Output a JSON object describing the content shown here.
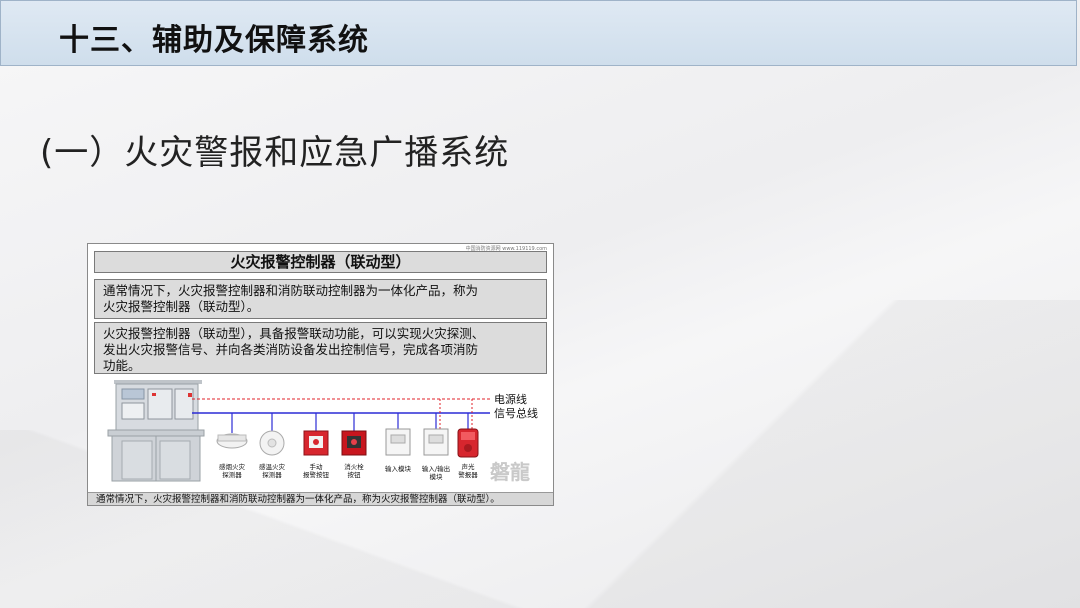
{
  "header": {
    "title": "十三、辅助及保障系统"
  },
  "subtitle": "(一）火灾警报和应急广播系统",
  "figure": {
    "source_note": "中国消防资源网 www.119119.com",
    "title": "火灾报警控制器（联动型）",
    "desc1_line1": "通常情况下，火灾报警控制器和消防联动控制器为一体化产品，称为",
    "desc1_line2": "火灾报警控制器（联动型）。",
    "desc2_line1": "火灾报警控制器（联动型），具备报警联动功能，可以实现火灾探测、",
    "desc2_line2": "发出火灾报警信号、并向各类消防设备发出控制信号，完成各项消防",
    "desc2_line3": "功能。",
    "power_line_label": "电源线",
    "signal_bus_label": "信号总线",
    "devices": [
      {
        "line1": "感烟火灾",
        "line2": "探测器"
      },
      {
        "line1": "感温火灾",
        "line2": "探测器"
      },
      {
        "line1": "手动",
        "line2": "报警按钮"
      },
      {
        "line1": "消火栓",
        "line2": "按钮"
      },
      {
        "line1": "输入模块",
        "line2": ""
      },
      {
        "line1": "输入/输出",
        "line2": "模块"
      },
      {
        "line1": "声光",
        "line2": "警报器"
      }
    ],
    "watermark": "磐龍",
    "caption": "通常情况下，火灾报警控制器和消防联动控制器为一体化产品，称为火灾报警控制器（联动型）。"
  },
  "colors": {
    "signal_bus": "#2b2bd6",
    "power_line": "#e0202a",
    "header_bg": "#d6e3f0"
  }
}
